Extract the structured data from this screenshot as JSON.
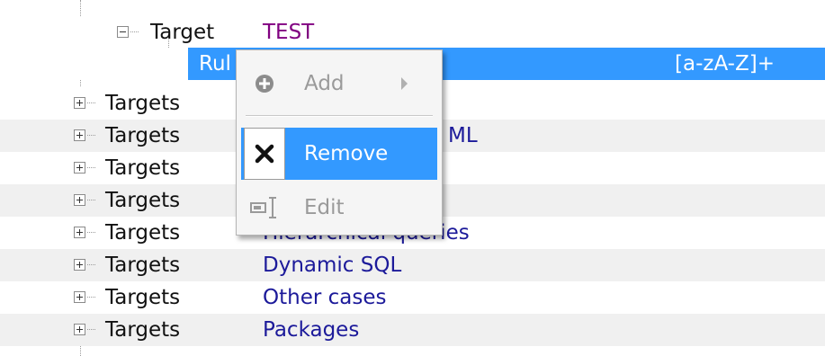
{
  "tree": {
    "top_partial_row": {
      "label": ""
    },
    "target_node": {
      "label": "Target",
      "value": "TEST"
    },
    "selected_row": {
      "label": "Rul",
      "pattern": "[a-zA-Z]+"
    },
    "rows": [
      {
        "label": "Targets",
        "value": ""
      },
      {
        "label": "Targets",
        "value": "ML"
      },
      {
        "label": "Targets",
        "value": ""
      },
      {
        "label": "Targets",
        "value": ""
      },
      {
        "label": "Targets",
        "value": "Hierarchical queries"
      },
      {
        "label": "Targets",
        "value": "Dynamic SQL"
      },
      {
        "label": "Targets",
        "value": "Other cases"
      },
      {
        "label": "Targets",
        "value": "Packages"
      }
    ]
  },
  "context_menu": {
    "items": [
      {
        "label": "Add",
        "icon": "plus-circle-icon",
        "enabled": false,
        "has_submenu": true
      },
      {
        "label": "Remove",
        "icon": "close-x-icon",
        "enabled": true,
        "highlighted": true
      },
      {
        "label": "Edit",
        "icon": "edit-cursor-icon",
        "enabled": false
      }
    ]
  },
  "colors": {
    "selection": "#3399ff",
    "value_text": "#1c1a9a",
    "target_value_text": "#800080",
    "alt_row": "#f0f0f0"
  }
}
